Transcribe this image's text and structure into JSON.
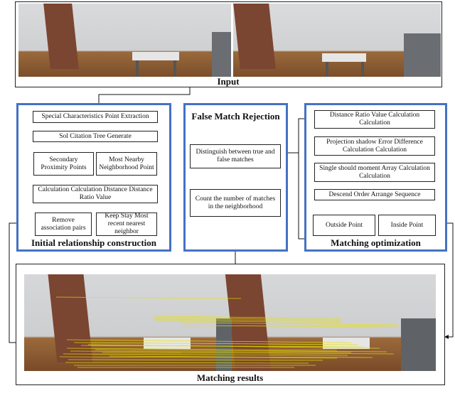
{
  "input": {
    "title": "Input",
    "images": [
      "left-view-photo",
      "right-view-photo"
    ]
  },
  "initial_relationship": {
    "title": "Initial relationship construction",
    "steps": {
      "extract": "Special Characteristics Point Extraction",
      "tree": "Sol Citation Tree Generate",
      "secondary": "Secondary Proximity Points",
      "nearby": "Most Nearby Neighborhood Point",
      "ratio": "Calculation Calculation Distance Distance Ratio Value",
      "remove": "Remove association pairs",
      "keep": "Keep Stay Most recent nearest neighbor"
    }
  },
  "false_match": {
    "title": "False Match Rejection",
    "steps": {
      "distinguish": "Distinguish between true and false matches",
      "count": "Count the number of matches in the neighborhood"
    }
  },
  "matching_opt": {
    "title": "Matching optimization",
    "steps": {
      "distance": "Distance Ratio Value Calculation Calculation",
      "projection": "Projection shadow Error Difference Calculation Calculation",
      "single": "Single should moment Array Calculation Calculation",
      "descend": "Descend Order Arrange Sequence",
      "outside": "Outside Point",
      "inside": "Inside Point"
    }
  },
  "results": {
    "title": "Matching results"
  },
  "colors": {
    "panel_border": "#4472c4",
    "match_lines": "#e8e000"
  }
}
